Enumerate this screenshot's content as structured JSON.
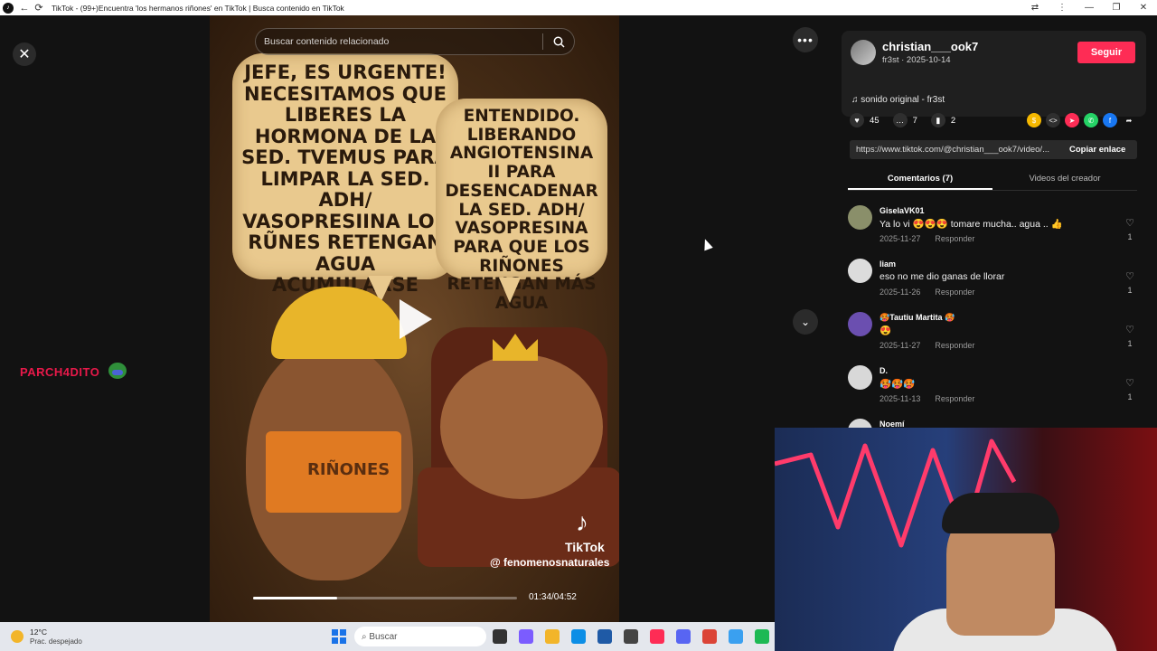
{
  "window": {
    "title": "TikTok - (99+)Encuentra 'los hermanos riñones' en TikTok | Busca contenido en TikTok"
  },
  "overlay": {
    "streamer_name": "PARCH4DITO"
  },
  "video": {
    "search_placeholder": "Buscar contenido relacionado",
    "bubble_left": "JEFE, ES URGENTE! NECESITAMOS QUE LIBERES LA HORMONA DE LA SED. TVEMUS PARA LIMPAR LA SED. ADH/ VASOPRESIINA LOS RŨNES RETENGAN AGUA ACUMULARSE",
    "bubble_right": "ENTENDIDO. LIBERANDO ANGIOTENSINA II PARA DESENCADENAR LA SED. ADH/ VASOPRESINA PARA QUE LOS RIÑONES RETENGAN MÁS AGUA",
    "vest_text": "RIÑONES",
    "watermark_brand": "TikTok",
    "watermark_handle": "@ fenomenosnaturales",
    "timecode": "01:34/04:52",
    "progress": 0.32
  },
  "author": {
    "name": "christian___ook7",
    "subline": "fr3st · 2025-10-14",
    "follow_label": "Seguir",
    "music": "sonido original - fr3st"
  },
  "stats": {
    "likes": "45",
    "comments": "7",
    "saves": "2"
  },
  "link": {
    "url": "https://www.tiktok.com/@christian___ook7/video/...",
    "copy_label": "Copiar enlace"
  },
  "tabs": {
    "comments": "Comentarios (7)",
    "creator_videos": "Videos del creador"
  },
  "comments": [
    {
      "user": "GiselaVK01",
      "text": "Ya lo vi 😍😍😍 tomare mucha.. agua .. 👍",
      "date": "2025-11-27",
      "reply": "Responder",
      "likes": "1",
      "avatar_color": "#8a8f6a"
    },
    {
      "user": "liam",
      "text": "eso no me dio ganas de llorar",
      "date": "2025-11-26",
      "reply": "Responder",
      "likes": "1",
      "avatar_color": "#dcdcdc"
    },
    {
      "user": "🥵Tautiu Martita 🥵",
      "text": "😍",
      "date": "2025-11-27",
      "reply": "Responder",
      "likes": "1",
      "avatar_color": "#6b4fb0"
    },
    {
      "user": "D.",
      "text": "🥵🥵🥵",
      "date": "2025-11-13",
      "reply": "Responder",
      "likes": "1",
      "avatar_color": "#d8d8d8"
    }
  ],
  "next_comment_user": "Noemí",
  "taskbar": {
    "temperature": "12°C",
    "weather": "Prac. despejado",
    "search_label": "Buscar"
  },
  "colors": {
    "accent": "#fe2c55",
    "overlay_text": "#e8194a"
  }
}
